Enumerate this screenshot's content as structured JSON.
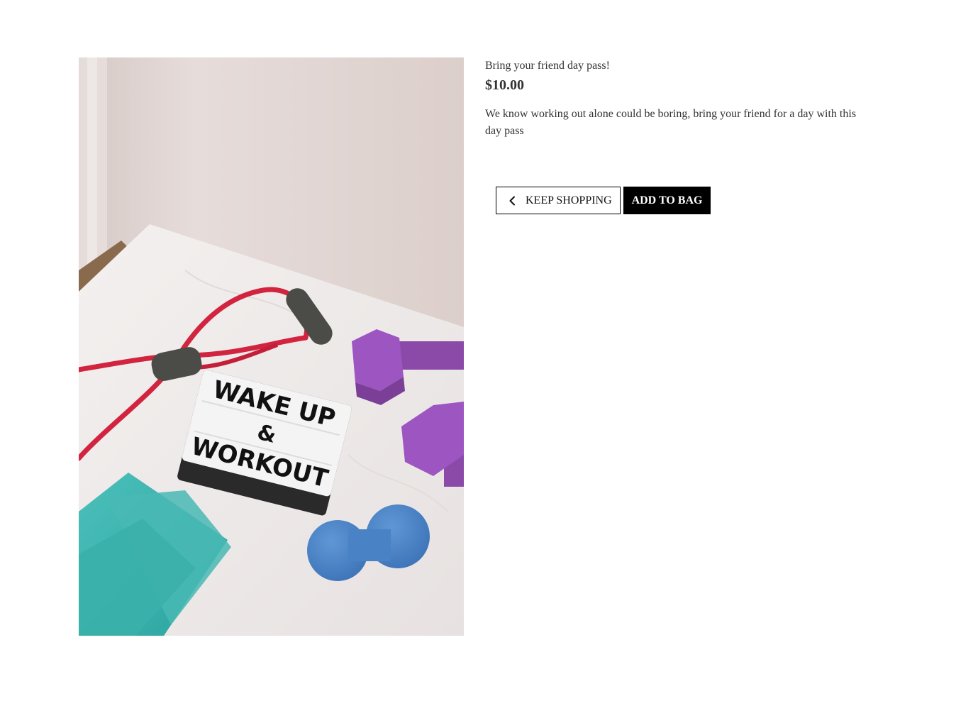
{
  "product": {
    "name": "Bring your friend day pass!",
    "price": "$10.00",
    "description": "We know working out alone could be boring, bring your friend for a day with this day pass",
    "image": {
      "lightbox_line1": "WAKE UP",
      "lightbox_line2": "&",
      "lightbox_line3": "WORKOUT"
    }
  },
  "actions": {
    "keep_shopping_label": "KEEP SHOPPING",
    "keep_shopping_icon": "chevron-left-icon",
    "add_to_bag_label": "ADD TO BAG"
  },
  "colors": {
    "primary_button": "#000000",
    "primary_button_text": "#ffffff",
    "text": "#333333"
  }
}
